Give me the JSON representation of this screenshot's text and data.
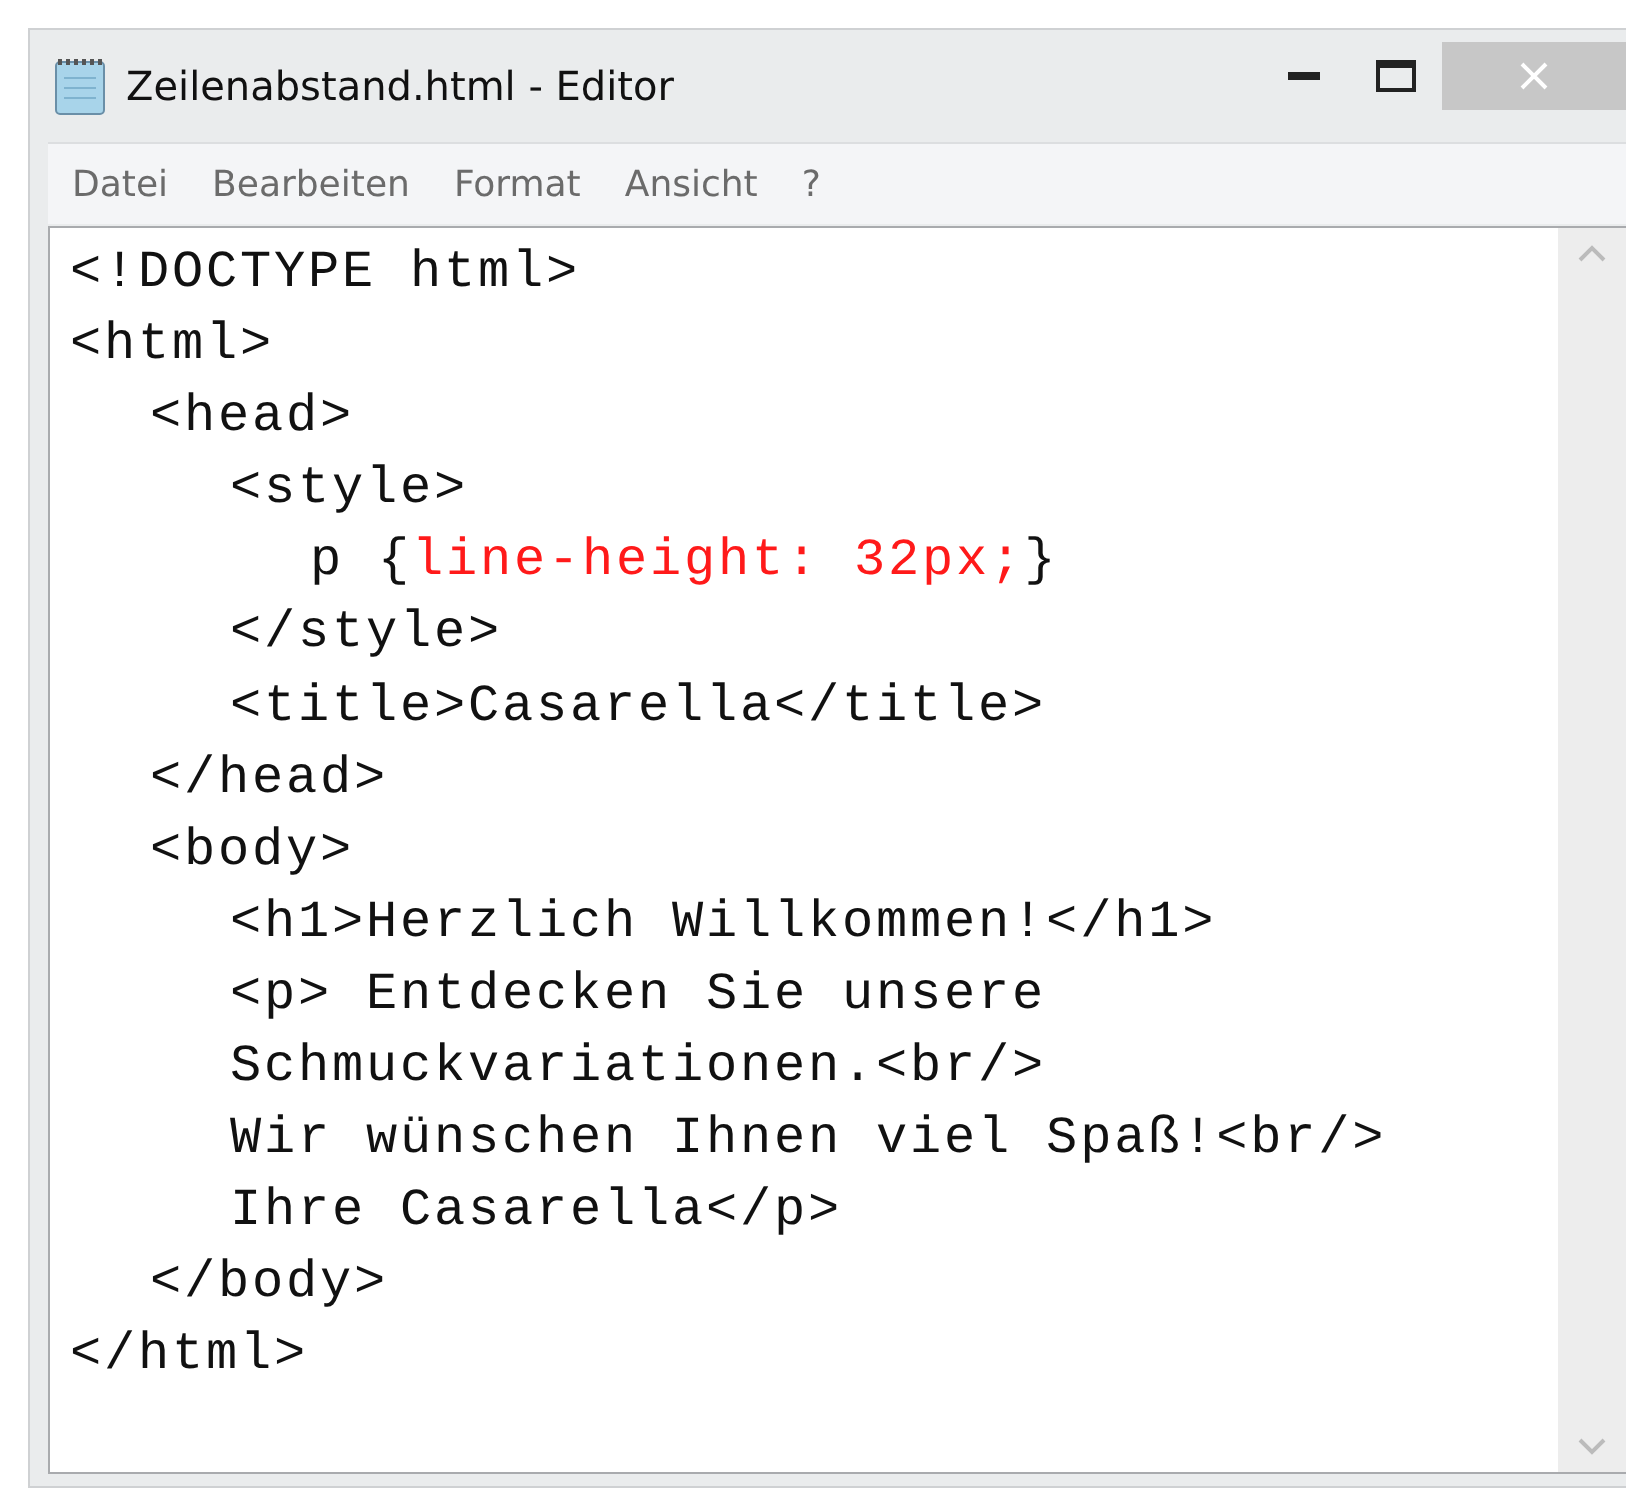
{
  "window": {
    "title": "Zeilenabstand.html - Editor"
  },
  "menu": [
    "Datei",
    "Bearbeiten",
    "Format",
    "Ansicht",
    "?"
  ],
  "editor": {
    "lines": [
      {
        "parts": [
          {
            "text": "<!DOCTYPE html>",
            "kind": "code"
          }
        ]
      },
      {
        "parts": [
          {
            "text": "<html>",
            "kind": "code"
          }
        ],
        "children": [
          {
            "parts": [
              {
                "text": "<head>",
                "kind": "code"
              }
            ],
            "children": [
              {
                "parts": [
                  {
                    "text": "<style>",
                    "kind": "code"
                  }
                ],
                "children": [
                  {
                    "parts": [
                      {
                        "text": "p {",
                        "kind": "code"
                      },
                      {
                        "text": "line-height: 32px;",
                        "kind": "highlight"
                      },
                      {
                        "text": "}",
                        "kind": "code"
                      }
                    ]
                  }
                ]
              },
              {
                "parts": [
                  {
                    "text": "</style>",
                    "kind": "code"
                  }
                ]
              },
              {
                "parts": [
                  {
                    "text": "<title>Casarella</title>",
                    "kind": "code"
                  }
                ]
              }
            ]
          },
          {
            "parts": [
              {
                "text": "</head>",
                "kind": "code"
              }
            ]
          },
          {
            "parts": [
              {
                "text": "<body>",
                "kind": "code"
              }
            ],
            "children": [
              {
                "parts": [
                  {
                    "text": "<h1>Herzlich Willkommen!</h1>",
                    "kind": "code"
                  }
                ]
              },
              {
                "parts": [
                  {
                    "text": "<p> Entdecken Sie unsere",
                    "kind": "code"
                  }
                ]
              },
              {
                "parts": [
                  {
                    "text": "Schmuckvariationen.<br/>",
                    "kind": "code"
                  }
                ]
              },
              {
                "parts": [
                  {
                    "text": "Wir wünschen Ihnen viel Spaß!<br/>",
                    "kind": "code"
                  }
                ]
              },
              {
                "parts": [
                  {
                    "text": "Ihre Casarella</p>",
                    "kind": "code"
                  }
                ]
              }
            ]
          },
          {
            "parts": [
              {
                "text": "</body>",
                "kind": "code"
              }
            ]
          }
        ]
      },
      {
        "parts": [
          {
            "text": "</html>",
            "kind": "code"
          }
        ]
      }
    ]
  }
}
